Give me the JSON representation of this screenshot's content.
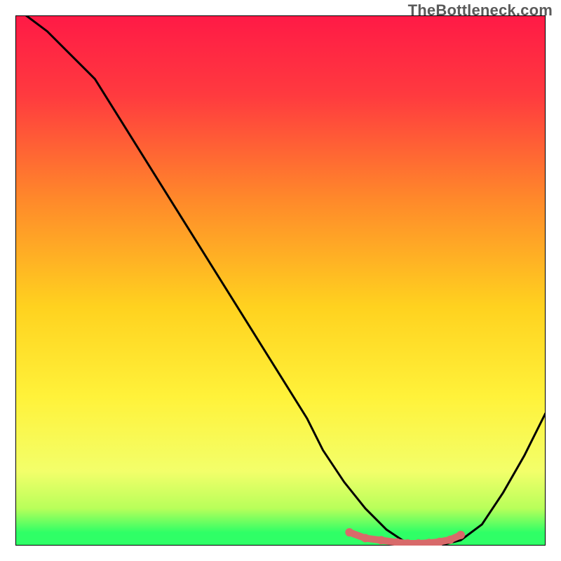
{
  "watermark": "TheBottleneck.com",
  "chart_data": {
    "type": "line",
    "title": "",
    "xlabel": "",
    "ylabel": "",
    "x_range": [
      0,
      100
    ],
    "y_range": [
      0,
      100
    ],
    "grid": false,
    "legend": false,
    "gradient_stops": [
      {
        "offset": 0.0,
        "color": "#ff1a46"
      },
      {
        "offset": 0.15,
        "color": "#ff3a3f"
      },
      {
        "offset": 0.35,
        "color": "#ff8a2a"
      },
      {
        "offset": 0.55,
        "color": "#ffd21f"
      },
      {
        "offset": 0.72,
        "color": "#fff23a"
      },
      {
        "offset": 0.86,
        "color": "#f3ff6a"
      },
      {
        "offset": 0.93,
        "color": "#b8ff5a"
      },
      {
        "offset": 0.975,
        "color": "#2fff66"
      },
      {
        "offset": 1.0,
        "color": "#2fff66"
      }
    ],
    "series": [
      {
        "name": "bottleneck-curve",
        "stroke": "#000000",
        "x": [
          2,
          6,
          10,
          15,
          20,
          25,
          30,
          35,
          40,
          45,
          50,
          55,
          58,
          62,
          66,
          70,
          73,
          76,
          80,
          84,
          88,
          92,
          96,
          100
        ],
        "y": [
          100,
          97,
          93,
          88,
          80,
          72,
          64,
          56,
          48,
          40,
          32,
          24,
          18,
          12,
          7,
          3,
          1,
          0,
          0,
          1,
          4,
          10,
          17,
          25
        ]
      },
      {
        "name": "optimal-band",
        "stroke": "#d86a6a",
        "fill": "#d86a6a",
        "marker": true,
        "x": [
          63,
          66,
          69,
          72,
          74,
          76,
          78,
          80,
          82,
          84
        ],
        "y": [
          2.5,
          1.4,
          1.0,
          0.6,
          0.4,
          0.4,
          0.5,
          0.7,
          1.1,
          2.0
        ]
      }
    ]
  }
}
